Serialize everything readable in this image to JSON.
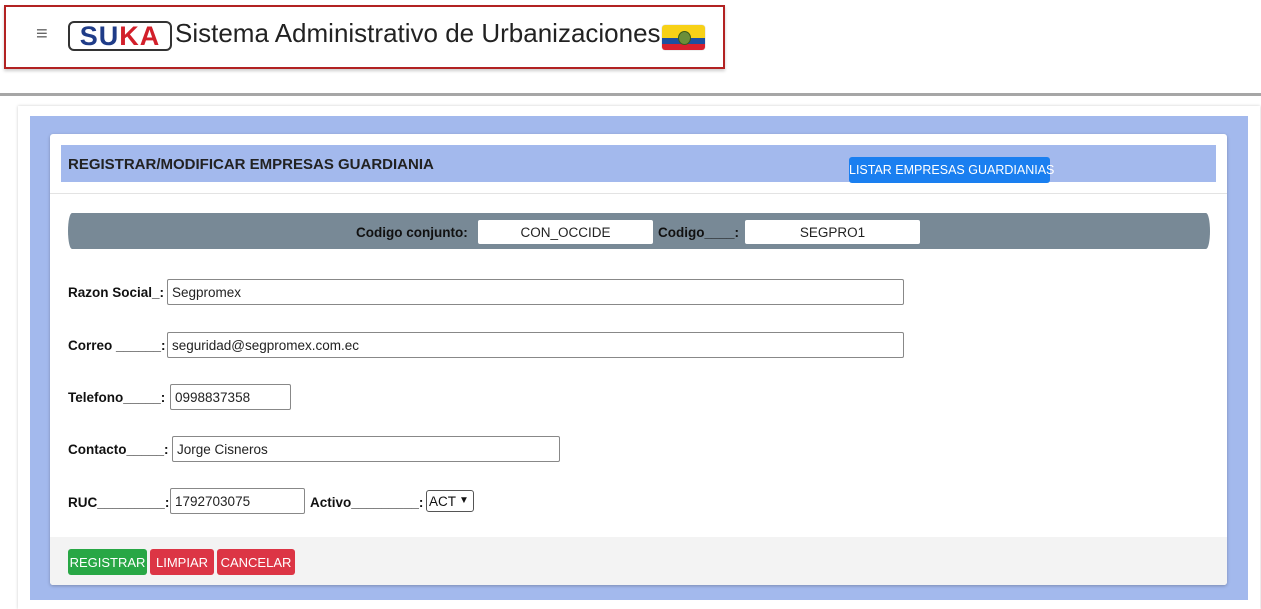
{
  "header": {
    "menu_glyph": "≡",
    "logo_su": "SU",
    "logo_ka": "KA",
    "title": "Sistema Administrativo de Urbanizaciones"
  },
  "form": {
    "title": "REGISTRAR/MODIFICAR EMPRESAS GUARDIANIA",
    "list_button": "LISTAR EMPRESAS GUARDIANIAS",
    "codigo_conjunto_label": "Codigo conjunto:",
    "codigo_conjunto_value": "CON_OCCIDE",
    "codigo_label": "Codigo____:",
    "codigo_value": "SEGPRO1",
    "razon_social_label": "Razon Social_:",
    "razon_social_value": "Segpromex",
    "correo_label": "Correo ______:",
    "correo_value": "seguridad@segpromex.com.ec",
    "telefono_label": "Telefono_____:",
    "telefono_value": "0998837358",
    "contacto_label": "Contacto_____:",
    "contacto_value": "Jorge Cisneros",
    "ruc_label": "RUC_________:",
    "ruc_value": "1792703075",
    "activo_label": "Activo_________:",
    "activo_value": "ACT"
  },
  "actions": {
    "register": "REGISTRAR",
    "clear": "LIMPIAR",
    "cancel": "CANCELAR"
  },
  "colors": {
    "frame_blue": "#a3b9ed",
    "primary": "#1a7ff0",
    "success": "#28a745",
    "danger": "#dc3545",
    "code_bar": "#788996",
    "brand_border": "#b22222"
  },
  "icons": {
    "menu": "hamburger-icon",
    "flag": "ecuador-flag-icon"
  }
}
